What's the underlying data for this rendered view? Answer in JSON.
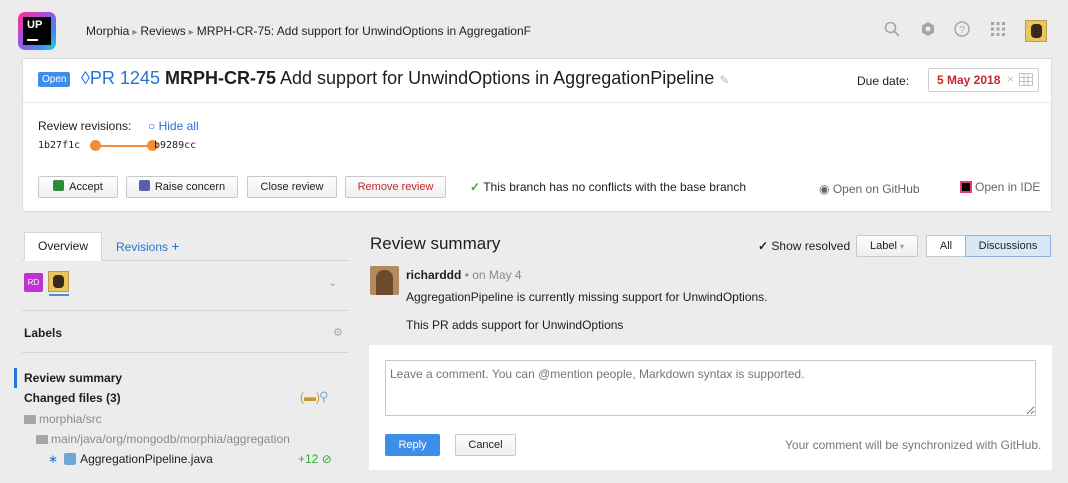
{
  "topbar": {
    "logo_text": "UP",
    "breadcrumbs": [
      "Morphia",
      "Reviews",
      "MRPH-CR-75: Add support for UnwindOptions in AggregationF"
    ],
    "icons": [
      "search-icon",
      "hub-icon",
      "help-icon",
      "apps-grid-icon",
      "user-avatar-icon"
    ]
  },
  "review": {
    "status": "Open",
    "pr_ref": "PR 1245",
    "key": "MRPH-CR-75",
    "title": "Add support for UnwindOptions in AggregationPipeline",
    "due_label": "Due date:",
    "due_date": "5 May 2018",
    "revisions_label": "Review revisions:",
    "hide_all": "Hide all",
    "rev_from": "1b27f1c",
    "rev_to": "b9289cc",
    "accept": "Accept",
    "raise_concern": "Raise concern",
    "close_review": "Close review",
    "remove_review": "Remove review",
    "branch_status": "This branch has no conflicts with the base branch",
    "open_github": "Open on GitHub",
    "open_ide": "Open in IDE"
  },
  "sidebar": {
    "tabs": [
      "Overview",
      "Revisions"
    ],
    "participants": [
      {
        "initials": "RD",
        "color": "#c033d3"
      }
    ],
    "labels_heading": "Labels",
    "review_summary": "Review summary",
    "changed_files": "Changed files (3)",
    "folder1": "morphia/src",
    "folder2": "main/java/org/mongodb/morphia/aggregation",
    "file": "AggregationPipeline.java",
    "file_delta": "+12"
  },
  "summary": {
    "heading": "Review summary",
    "show_resolved": "Show resolved",
    "label_btn": "Label",
    "filter_all": "All",
    "filter_discussions": "Discussions",
    "comment": {
      "author": "richarddd",
      "when": "on May 4",
      "line1": "AggregationPipeline is currently missing support for UnwindOptions.",
      "line2": "This PR adds support for UnwindOptions"
    },
    "composer": {
      "placeholder": "Leave a comment. You can @mention people, Markdown syntax is supported.",
      "reply": "Reply",
      "cancel": "Cancel",
      "sync_note": "Your comment will be synchronized with GitHub."
    }
  },
  "colors": {
    "accent": "#2474d6",
    "danger": "#c5272d",
    "success": "#37a93c",
    "revision": "#f28d35"
  }
}
